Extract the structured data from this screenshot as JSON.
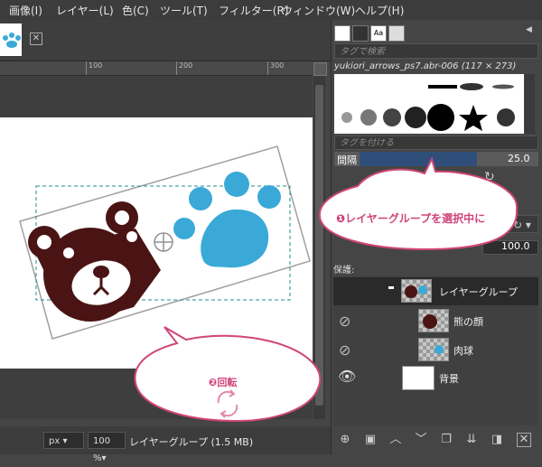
{
  "menubar": {
    "items": [
      "画像(I)",
      "レイヤー(L)",
      "色(C)",
      "ツール(T)",
      "フィルター(R)",
      "ウィンドウ(W)",
      "ヘルプ(H)"
    ]
  },
  "ruler": {
    "ticks": [
      "100",
      "200",
      "300"
    ]
  },
  "statusbar": {
    "unit": "px",
    "zoom": "100 %",
    "text": "レイヤーグループ (1.5 MB)"
  },
  "brushes": {
    "tag_filter_placeholder": "タグで検索",
    "brush_name": "yukiori_arrows_ps7.abr-006 (117 × 273)",
    "tag_assign_placeholder": "タグを付ける",
    "spacing_label": "間隔",
    "spacing_value": "25.0"
  },
  "layers": {
    "opacity_value": "100.0",
    "lock_label": "保護:",
    "items": [
      {
        "name": "レイヤーグループ",
        "selected": true
      },
      {
        "name": "熊の顔",
        "selected": false
      },
      {
        "name": "肉球",
        "selected": false
      },
      {
        "name": "背景",
        "selected": false
      }
    ]
  },
  "callouts": {
    "layer_group_note": "❶レイヤーグループを選択中に",
    "rotate_note": "❷回転"
  },
  "colors": {
    "bear_brown": "#4a1414",
    "paw_blue": "#3aa9d8",
    "callout_pink": "#d0457a",
    "selection_accent": "#2f4f7a"
  }
}
